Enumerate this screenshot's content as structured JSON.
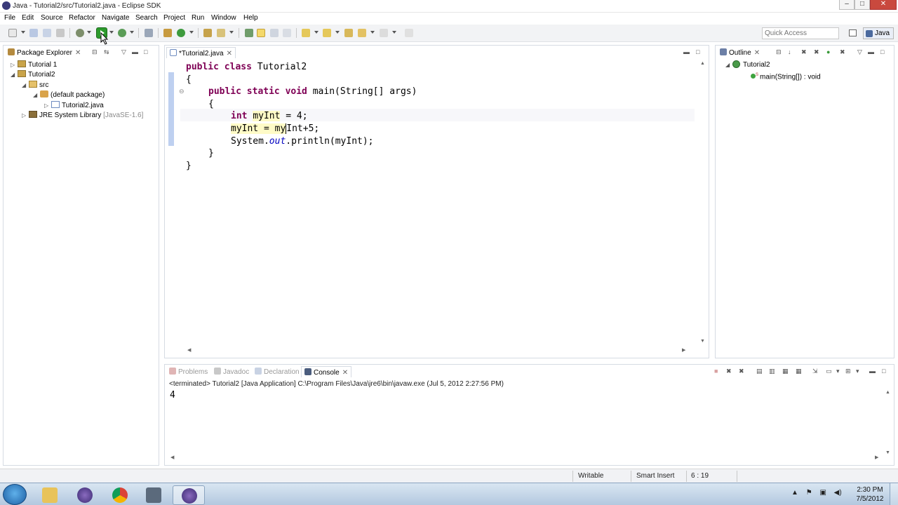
{
  "window": {
    "title": "Java - Tutorial2/src/Tutorial2.java - Eclipse SDK",
    "minimize": "–",
    "maximize": "□",
    "close": "✕"
  },
  "menu": [
    "File",
    "Edit",
    "Source",
    "Refactor",
    "Navigate",
    "Search",
    "Project",
    "Run",
    "Window",
    "Help"
  ],
  "toolbar": {
    "quick_access_placeholder": "Quick Access",
    "perspective_label": "Java",
    "run_button_color": "#2c9a2c"
  },
  "package_explorer": {
    "tab_label": "Package Explorer",
    "tree": [
      {
        "label": "Tutorial 1",
        "icon": "project-icon",
        "arrow": "▷"
      },
      {
        "label": "Tutorial2",
        "icon": "project-icon",
        "arrow": "◢"
      },
      {
        "label": "src",
        "icon": "source-folder-icon",
        "arrow": "◢"
      },
      {
        "label": "(default package)",
        "icon": "package-icon",
        "arrow": "◢"
      },
      {
        "label": "Tutorial2.java",
        "icon": "java-file-icon",
        "arrow": "▷"
      },
      {
        "label": "JRE System Library",
        "suffix": "[JavaSE-1.6]",
        "icon": "library-icon",
        "arrow": "▷"
      }
    ]
  },
  "editor": {
    "tab_label": "*Tutorial2.java",
    "lines": [
      {
        "kw": "public class",
        "rest": " Tutorial2"
      },
      {
        "text": "{"
      },
      {
        "kw": "public static void",
        "rest": " main(String[] args)"
      },
      {
        "text": "{"
      },
      {
        "kw": "int",
        "var": "myInt",
        "rest": " = 4;"
      },
      {
        "text_a": "myInt = my",
        "text_b": "Int+5;"
      },
      {
        "text_a": "System.",
        "field": "out",
        "text_b": ".println(myInt);"
      },
      {
        "text": "}"
      },
      {
        "text": "}"
      }
    ],
    "keyword_color": "#7f0055"
  },
  "outline": {
    "tab_label": "Outline",
    "class_name": "Tutorial2",
    "method_modifier": "S",
    "method_name": "main(String[]) : void"
  },
  "bottom_tabs": {
    "problems": "Problems",
    "javadoc": "Javadoc",
    "declaration": "Declaration",
    "console": "Console"
  },
  "console": {
    "header": "<terminated> Tutorial2 [Java Application] C:\\Program Files\\Java\\jre6\\bin\\javaw.exe (Jul 5, 2012 2:27:56 PM)",
    "output": "4"
  },
  "status": {
    "writable": "Writable",
    "insert_mode": "Smart Insert",
    "position": "6 : 19"
  },
  "taskbar": {
    "time": "2:30 PM",
    "date": "7/5/2012"
  }
}
